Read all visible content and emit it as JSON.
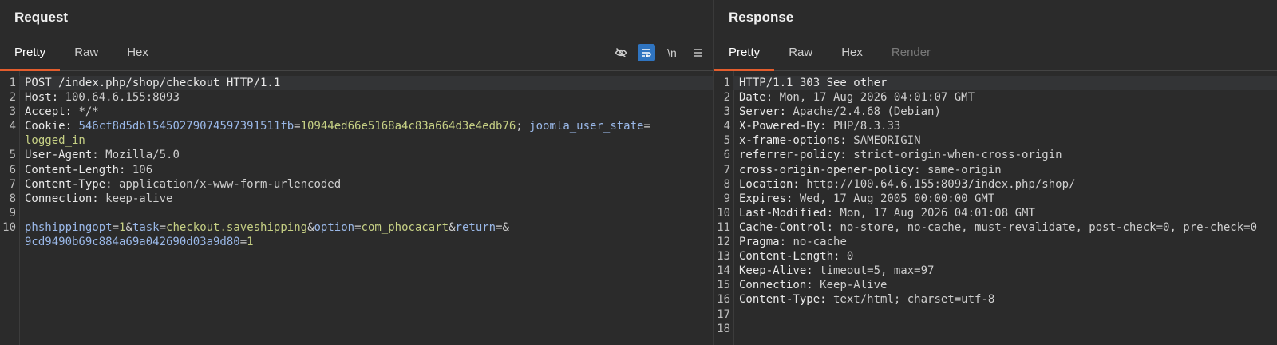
{
  "request": {
    "title": "Request",
    "tabs": [
      "Pretty",
      "Raw",
      "Hex"
    ],
    "lines": [
      {
        "n": "1",
        "parts": [
          {
            "t": "POST /index.php/shop/checkout HTTP/1.1",
            "c": "k"
          }
        ]
      },
      {
        "n": "2",
        "parts": [
          {
            "t": "Host: ",
            "c": "k"
          },
          {
            "t": "100.64.6.155:8093",
            "c": "v"
          }
        ]
      },
      {
        "n": "3",
        "parts": [
          {
            "t": "Accept: ",
            "c": "k"
          },
          {
            "t": "*/*",
            "c": "v"
          }
        ]
      },
      {
        "n": "4",
        "parts": [
          {
            "t": "Cookie: ",
            "c": "k"
          },
          {
            "t": "546cf8d5db15450279074597391511fb",
            "c": "p"
          },
          {
            "t": "=",
            "c": "v"
          },
          {
            "t": "10944ed66e5168a4c83a664d3e4edb76",
            "c": "y"
          },
          {
            "t": "; ",
            "c": "v"
          },
          {
            "t": "joomla_user_state",
            "c": "p"
          },
          {
            "t": "=",
            "c": "v"
          }
        ]
      },
      {
        "n": "",
        "parts": [
          {
            "t": "logged_in",
            "c": "y"
          }
        ]
      },
      {
        "n": "5",
        "parts": [
          {
            "t": "User-Agent: ",
            "c": "k"
          },
          {
            "t": "Mozilla/5.0",
            "c": "v"
          }
        ]
      },
      {
        "n": "6",
        "parts": [
          {
            "t": "Content-Length: ",
            "c": "k"
          },
          {
            "t": "106",
            "c": "v"
          }
        ]
      },
      {
        "n": "7",
        "parts": [
          {
            "t": "Content-Type: ",
            "c": "k"
          },
          {
            "t": "application/x-www-form-urlencoded",
            "c": "v"
          }
        ]
      },
      {
        "n": "8",
        "parts": [
          {
            "t": "Connection: ",
            "c": "k"
          },
          {
            "t": "keep-alive",
            "c": "v"
          }
        ]
      },
      {
        "n": "9",
        "parts": [
          {
            "t": "",
            "c": "v"
          }
        ]
      },
      {
        "n": "10",
        "parts": [
          {
            "t": "phshippingopt",
            "c": "p"
          },
          {
            "t": "=",
            "c": "v"
          },
          {
            "t": "1",
            "c": "y"
          },
          {
            "t": "&",
            "c": "v"
          },
          {
            "t": "task",
            "c": "p"
          },
          {
            "t": "=",
            "c": "v"
          },
          {
            "t": "checkout.saveshipping",
            "c": "y"
          },
          {
            "t": "&",
            "c": "v"
          },
          {
            "t": "option",
            "c": "p"
          },
          {
            "t": "=",
            "c": "v"
          },
          {
            "t": "com_phocacart",
            "c": "y"
          },
          {
            "t": "&",
            "c": "v"
          },
          {
            "t": "return",
            "c": "p"
          },
          {
            "t": "=&",
            "c": "v"
          }
        ]
      },
      {
        "n": "",
        "parts": [
          {
            "t": "9cd9490b69c884a69a042690d03a9d80",
            "c": "p"
          },
          {
            "t": "=",
            "c": "v"
          },
          {
            "t": "1",
            "c": "y"
          }
        ]
      }
    ]
  },
  "response": {
    "title": "Response",
    "tabs": [
      "Pretty",
      "Raw",
      "Hex",
      "Render"
    ],
    "lines": [
      {
        "n": "1",
        "parts": [
          {
            "t": "HTTP/1.1 303 See other",
            "c": "k"
          }
        ]
      },
      {
        "n": "2",
        "parts": [
          {
            "t": "Date: ",
            "c": "k"
          },
          {
            "t": "Mon, 17 Aug 2026 04:01:07 GMT",
            "c": "v"
          }
        ]
      },
      {
        "n": "3",
        "parts": [
          {
            "t": "Server: ",
            "c": "k"
          },
          {
            "t": "Apache/2.4.68 (Debian)",
            "c": "v"
          }
        ]
      },
      {
        "n": "4",
        "parts": [
          {
            "t": "X-Powered-By: ",
            "c": "k"
          },
          {
            "t": "PHP/8.3.33",
            "c": "v"
          }
        ]
      },
      {
        "n": "5",
        "parts": [
          {
            "t": "x-frame-options: ",
            "c": "k"
          },
          {
            "t": "SAMEORIGIN",
            "c": "v"
          }
        ]
      },
      {
        "n": "6",
        "parts": [
          {
            "t": "referrer-policy: ",
            "c": "k"
          },
          {
            "t": "strict-origin-when-cross-origin",
            "c": "v"
          }
        ]
      },
      {
        "n": "7",
        "parts": [
          {
            "t": "cross-origin-opener-policy: ",
            "c": "k"
          },
          {
            "t": "same-origin",
            "c": "v"
          }
        ]
      },
      {
        "n": "8",
        "parts": [
          {
            "t": "Location: ",
            "c": "k"
          },
          {
            "t": "http://100.64.6.155:8093/index.php/shop/",
            "c": "v"
          }
        ]
      },
      {
        "n": "9",
        "parts": [
          {
            "t": "Expires: ",
            "c": "k"
          },
          {
            "t": "Wed, 17 Aug 2005 00:00:00 GMT",
            "c": "v"
          }
        ]
      },
      {
        "n": "10",
        "parts": [
          {
            "t": "Last-Modified: ",
            "c": "k"
          },
          {
            "t": "Mon, 17 Aug 2026 04:01:08 GMT",
            "c": "v"
          }
        ]
      },
      {
        "n": "11",
        "parts": [
          {
            "t": "Cache-Control: ",
            "c": "k"
          },
          {
            "t": "no-store, no-cache, must-revalidate, post-check=0, pre-check=0",
            "c": "v"
          }
        ]
      },
      {
        "n": "12",
        "parts": [
          {
            "t": "Pragma: ",
            "c": "k"
          },
          {
            "t": "no-cache",
            "c": "v"
          }
        ]
      },
      {
        "n": "13",
        "parts": [
          {
            "t": "Content-Length: ",
            "c": "k"
          },
          {
            "t": "0",
            "c": "v"
          }
        ]
      },
      {
        "n": "14",
        "parts": [
          {
            "t": "Keep-Alive: ",
            "c": "k"
          },
          {
            "t": "timeout=5, max=97",
            "c": "v"
          }
        ]
      },
      {
        "n": "15",
        "parts": [
          {
            "t": "Connection: ",
            "c": "k"
          },
          {
            "t": "Keep-Alive",
            "c": "v"
          }
        ]
      },
      {
        "n": "16",
        "parts": [
          {
            "t": "Content-Type: ",
            "c": "k"
          },
          {
            "t": "text/html; charset=utf-8",
            "c": "v"
          }
        ]
      },
      {
        "n": "17",
        "parts": [
          {
            "t": "",
            "c": "v"
          }
        ]
      },
      {
        "n": "18",
        "parts": [
          {
            "t": "",
            "c": "v"
          }
        ]
      }
    ]
  },
  "toolbar": {
    "icons": [
      "eye-slash-icon",
      "wrap-lines-icon",
      "newline-toggle-icon",
      "menu-icon"
    ],
    "newline_label": "\\n"
  },
  "colors": {
    "accent_tab": "#e35d2d",
    "active_tool": "#2f74c0",
    "background": "#2b2b2b"
  }
}
